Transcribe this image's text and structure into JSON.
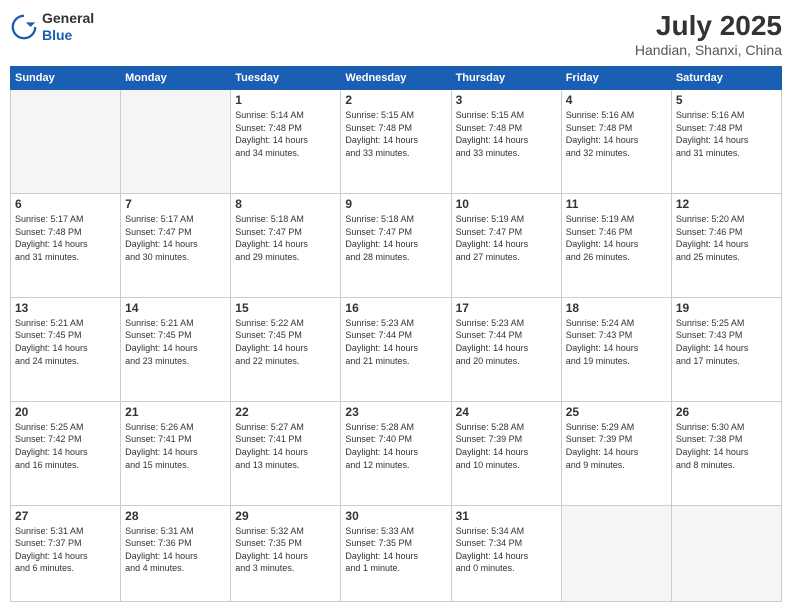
{
  "header": {
    "logo": {
      "general": "General",
      "blue": "Blue"
    },
    "title": "July 2025",
    "location": "Handian, Shanxi, China"
  },
  "weekdays": [
    "Sunday",
    "Monday",
    "Tuesday",
    "Wednesday",
    "Thursday",
    "Friday",
    "Saturday"
  ],
  "weeks": [
    [
      {
        "day": "",
        "info": ""
      },
      {
        "day": "",
        "info": ""
      },
      {
        "day": "1",
        "info": "Sunrise: 5:14 AM\nSunset: 7:48 PM\nDaylight: 14 hours\nand 34 minutes."
      },
      {
        "day": "2",
        "info": "Sunrise: 5:15 AM\nSunset: 7:48 PM\nDaylight: 14 hours\nand 33 minutes."
      },
      {
        "day": "3",
        "info": "Sunrise: 5:15 AM\nSunset: 7:48 PM\nDaylight: 14 hours\nand 33 minutes."
      },
      {
        "day": "4",
        "info": "Sunrise: 5:16 AM\nSunset: 7:48 PM\nDaylight: 14 hours\nand 32 minutes."
      },
      {
        "day": "5",
        "info": "Sunrise: 5:16 AM\nSunset: 7:48 PM\nDaylight: 14 hours\nand 31 minutes."
      }
    ],
    [
      {
        "day": "6",
        "info": "Sunrise: 5:17 AM\nSunset: 7:48 PM\nDaylight: 14 hours\nand 31 minutes."
      },
      {
        "day": "7",
        "info": "Sunrise: 5:17 AM\nSunset: 7:47 PM\nDaylight: 14 hours\nand 30 minutes."
      },
      {
        "day": "8",
        "info": "Sunrise: 5:18 AM\nSunset: 7:47 PM\nDaylight: 14 hours\nand 29 minutes."
      },
      {
        "day": "9",
        "info": "Sunrise: 5:18 AM\nSunset: 7:47 PM\nDaylight: 14 hours\nand 28 minutes."
      },
      {
        "day": "10",
        "info": "Sunrise: 5:19 AM\nSunset: 7:47 PM\nDaylight: 14 hours\nand 27 minutes."
      },
      {
        "day": "11",
        "info": "Sunrise: 5:19 AM\nSunset: 7:46 PM\nDaylight: 14 hours\nand 26 minutes."
      },
      {
        "day": "12",
        "info": "Sunrise: 5:20 AM\nSunset: 7:46 PM\nDaylight: 14 hours\nand 25 minutes."
      }
    ],
    [
      {
        "day": "13",
        "info": "Sunrise: 5:21 AM\nSunset: 7:45 PM\nDaylight: 14 hours\nand 24 minutes."
      },
      {
        "day": "14",
        "info": "Sunrise: 5:21 AM\nSunset: 7:45 PM\nDaylight: 14 hours\nand 23 minutes."
      },
      {
        "day": "15",
        "info": "Sunrise: 5:22 AM\nSunset: 7:45 PM\nDaylight: 14 hours\nand 22 minutes."
      },
      {
        "day": "16",
        "info": "Sunrise: 5:23 AM\nSunset: 7:44 PM\nDaylight: 14 hours\nand 21 minutes."
      },
      {
        "day": "17",
        "info": "Sunrise: 5:23 AM\nSunset: 7:44 PM\nDaylight: 14 hours\nand 20 minutes."
      },
      {
        "day": "18",
        "info": "Sunrise: 5:24 AM\nSunset: 7:43 PM\nDaylight: 14 hours\nand 19 minutes."
      },
      {
        "day": "19",
        "info": "Sunrise: 5:25 AM\nSunset: 7:43 PM\nDaylight: 14 hours\nand 17 minutes."
      }
    ],
    [
      {
        "day": "20",
        "info": "Sunrise: 5:25 AM\nSunset: 7:42 PM\nDaylight: 14 hours\nand 16 minutes."
      },
      {
        "day": "21",
        "info": "Sunrise: 5:26 AM\nSunset: 7:41 PM\nDaylight: 14 hours\nand 15 minutes."
      },
      {
        "day": "22",
        "info": "Sunrise: 5:27 AM\nSunset: 7:41 PM\nDaylight: 14 hours\nand 13 minutes."
      },
      {
        "day": "23",
        "info": "Sunrise: 5:28 AM\nSunset: 7:40 PM\nDaylight: 14 hours\nand 12 minutes."
      },
      {
        "day": "24",
        "info": "Sunrise: 5:28 AM\nSunset: 7:39 PM\nDaylight: 14 hours\nand 10 minutes."
      },
      {
        "day": "25",
        "info": "Sunrise: 5:29 AM\nSunset: 7:39 PM\nDaylight: 14 hours\nand 9 minutes."
      },
      {
        "day": "26",
        "info": "Sunrise: 5:30 AM\nSunset: 7:38 PM\nDaylight: 14 hours\nand 8 minutes."
      }
    ],
    [
      {
        "day": "27",
        "info": "Sunrise: 5:31 AM\nSunset: 7:37 PM\nDaylight: 14 hours\nand 6 minutes."
      },
      {
        "day": "28",
        "info": "Sunrise: 5:31 AM\nSunset: 7:36 PM\nDaylight: 14 hours\nand 4 minutes."
      },
      {
        "day": "29",
        "info": "Sunrise: 5:32 AM\nSunset: 7:35 PM\nDaylight: 14 hours\nand 3 minutes."
      },
      {
        "day": "30",
        "info": "Sunrise: 5:33 AM\nSunset: 7:35 PM\nDaylight: 14 hours\nand 1 minute."
      },
      {
        "day": "31",
        "info": "Sunrise: 5:34 AM\nSunset: 7:34 PM\nDaylight: 14 hours\nand 0 minutes."
      },
      {
        "day": "",
        "info": ""
      },
      {
        "day": "",
        "info": ""
      }
    ]
  ]
}
